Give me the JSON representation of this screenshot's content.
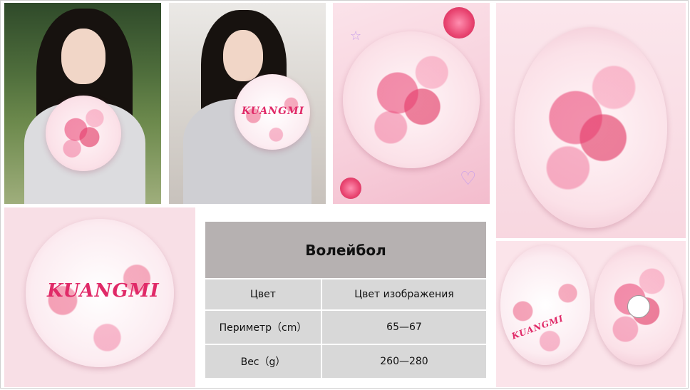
{
  "table": {
    "title": "Волейбол",
    "rows": [
      {
        "label": "Цвет",
        "value": "Цвет изображения"
      },
      {
        "label": "Периметр（cm）",
        "value": "65—67"
      },
      {
        "label": "Вес（g）",
        "value": "260—280"
      }
    ]
  },
  "product": {
    "brand": "KUANGMI"
  },
  "colors": {
    "accent": "#e02a68",
    "pink_bg": "#f8dfe6",
    "table_header": "#b6b1b1",
    "table_cell": "#d8d8d8"
  }
}
